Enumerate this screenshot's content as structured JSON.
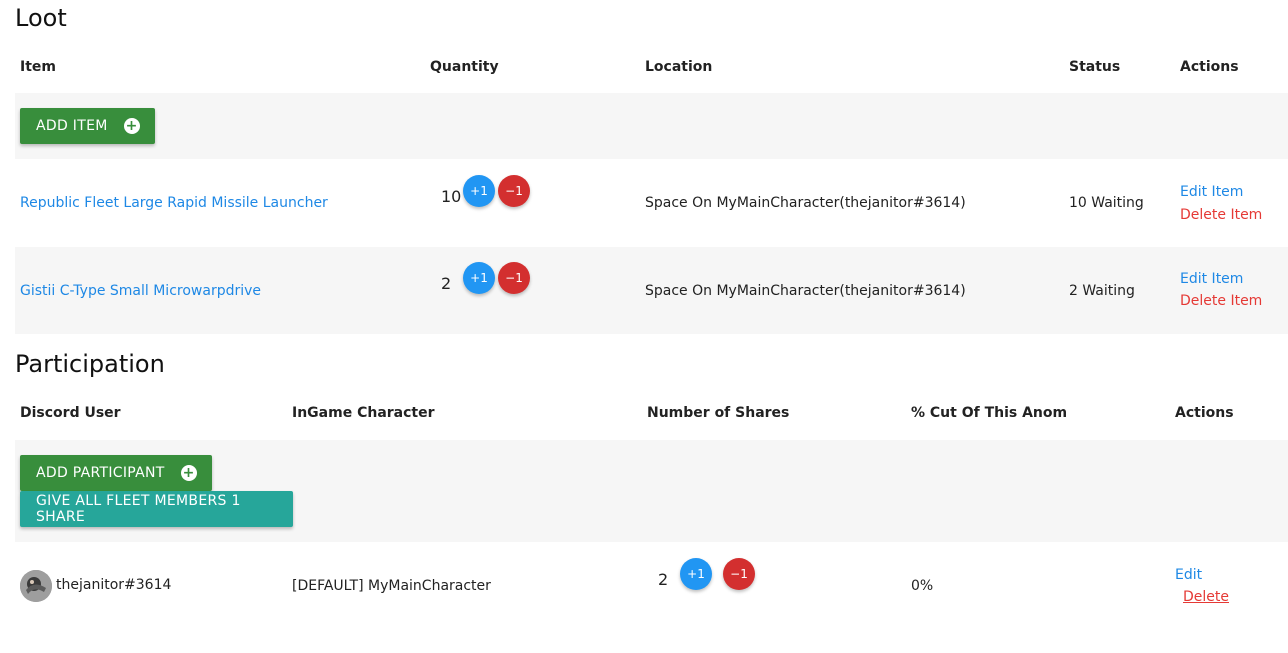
{
  "loot": {
    "title": "Loot",
    "headers": [
      "Item",
      "Quantity",
      "Location",
      "Status",
      "Actions"
    ],
    "add_button": "ADD ITEM",
    "rows": [
      {
        "item": "Republic Fleet Large Rapid Missile Launcher",
        "quantity": "10",
        "plus": "+1",
        "minus": "−1",
        "location": "Space On MyMainCharacter(thejanitor#3614)",
        "status": "10 Waiting",
        "edit": "Edit Item",
        "delete": "Delete Item"
      },
      {
        "item": "Gistii C-Type Small Microwarpdrive",
        "quantity": "2",
        "plus": "+1",
        "minus": "−1",
        "location": "Space On MyMainCharacter(thejanitor#3614)",
        "status": "2 Waiting",
        "edit": "Edit Item",
        "delete": "Delete Item"
      }
    ]
  },
  "participation": {
    "title": "Participation",
    "headers": [
      "Discord User",
      "InGame Character",
      "Number of Shares",
      "% Cut Of This Anom",
      "Actions"
    ],
    "add_button": "ADD PARTICIPANT",
    "give_button": "GIVE ALL FLEET MEMBERS 1 SHARE",
    "rows": [
      {
        "user": "thejanitor#3614",
        "character": "[DEFAULT] MyMainCharacter",
        "shares": "2",
        "plus": "+1",
        "minus": "−1",
        "cut": "0%",
        "edit": "Edit",
        "delete": "Delete"
      }
    ]
  },
  "icons": {
    "add": "plus-circle-icon",
    "avatar": "user-avatar"
  },
  "colors": {
    "green": "#388e3c",
    "teal": "#26a69a",
    "blue": "#2196f3",
    "red": "#d32f2f",
    "link_blue": "#1e88e5",
    "link_red": "#e53935"
  }
}
